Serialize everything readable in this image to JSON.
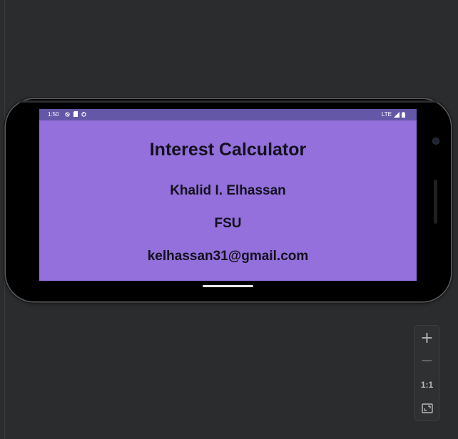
{
  "status_bar": {
    "time": "1:50",
    "network": "LTE",
    "left_icons": [
      "do-not-disturb-icon",
      "sim-card-icon",
      "sync-icon"
    ],
    "right_icons": [
      "signal-icon",
      "battery-icon"
    ]
  },
  "app": {
    "title": "Interest Calculator",
    "name": "Khalid I. Elhassan",
    "school": "FSU",
    "email": "kelhassan31@gmail.com",
    "background_color": "#9370db",
    "status_bar_color": "#6557a8"
  },
  "emulator_controls": {
    "zoom_in_label": "+",
    "zoom_out_label": "−",
    "reset_label": "1:1",
    "fit_icon": "fit-screen-icon"
  }
}
